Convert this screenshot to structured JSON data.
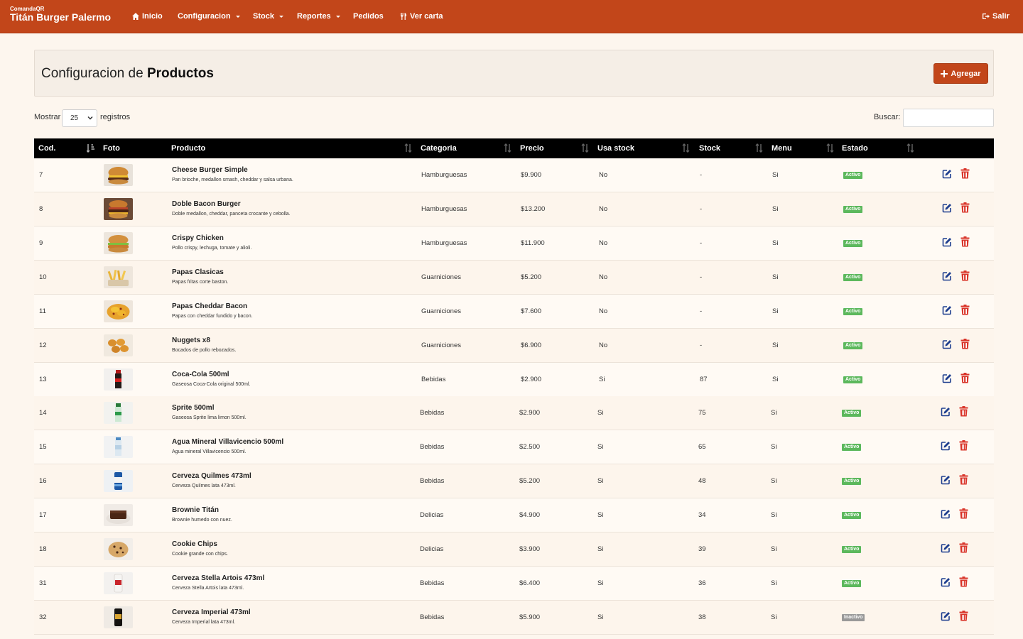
{
  "navbar": {
    "brand_small": "ComandaQR",
    "brand_big": "Titán Burger Palermo",
    "items": [
      {
        "label": "Inicio",
        "icon": "home-icon"
      },
      {
        "label": "Configuracion",
        "dropdown": true
      },
      {
        "label": "Stock",
        "dropdown": true
      },
      {
        "label": "Reportes",
        "dropdown": true
      },
      {
        "label": "Pedidos"
      },
      {
        "label": "Ver carta",
        "icon": "cutlery-icon"
      }
    ],
    "logout": "Salir"
  },
  "panel": {
    "title_prefix": "Configuracion de",
    "title_bold": "Productos",
    "add_label": "Agregar"
  },
  "controls": {
    "show_label": "Mostrar",
    "page_size": "25",
    "records_label": "registros",
    "search_label": "Buscar:",
    "search_value": ""
  },
  "table": {
    "columns": [
      "Cod.",
      "Foto",
      "Producto",
      "Categoria",
      "Precio",
      "Usa stock",
      "Stock",
      "Menu",
      "Estado"
    ],
    "rows": [
      {
        "cod": "7",
        "image": "cheeseburger",
        "name": "Cheese Burger Simple",
        "desc": "Pan brioche, medallon smash, cheddar y salsa urbana.",
        "category": "Hamburguesas",
        "price": "$9.900",
        "uses_stock": "No",
        "stock": "-",
        "menu": "Si",
        "status": "Activo"
      },
      {
        "cod": "8",
        "image": "bacon-burger",
        "name": "Doble Bacon Burger",
        "desc": "Doble medallon, cheddar, panceta crocante y cebolla.",
        "category": "Hamburguesas",
        "price": "$13.200",
        "uses_stock": "No",
        "stock": "-",
        "menu": "Si",
        "status": "Activo"
      },
      {
        "cod": "9",
        "image": "chicken-burger",
        "name": "Crispy Chicken",
        "desc": "Pollo crispy, lechuga, tomate y alioli.",
        "category": "Hamburguesas",
        "price": "$11.900",
        "uses_stock": "No",
        "stock": "-",
        "menu": "Si",
        "status": "Activo"
      },
      {
        "cod": "10",
        "image": "fries",
        "name": "Papas Clasicas",
        "desc": "Papas fritas corte baston.",
        "category": "Guarniciones",
        "price": "$5.200",
        "uses_stock": "No",
        "stock": "-",
        "menu": "Si",
        "status": "Activo"
      },
      {
        "cod": "11",
        "image": "cheddar-fries",
        "name": "Papas Cheddar Bacon",
        "desc": "Papas con cheddar fundido y bacon.",
        "category": "Guarniciones",
        "price": "$7.600",
        "uses_stock": "No",
        "stock": "-",
        "menu": "Si",
        "status": "Activo"
      },
      {
        "cod": "12",
        "image": "nuggets",
        "name": "Nuggets x8",
        "desc": "Bocados de pollo rebozados.",
        "category": "Guarniciones",
        "price": "$6.900",
        "uses_stock": "No",
        "stock": "-",
        "menu": "Si",
        "status": "Activo"
      },
      {
        "cod": "13",
        "image": "coca-cola",
        "name": "Coca-Cola 500ml",
        "desc": "Gaseosa Coca-Cola original 500ml.",
        "category": "Bebidas",
        "price": "$2.900",
        "uses_stock": "Si",
        "stock": "87",
        "menu": "Si",
        "status": "Activo"
      },
      {
        "cod": "14",
        "image": "sprite",
        "name": "Sprite 500ml",
        "desc": "Gaseosa Sprite lima limon 500ml.",
        "category": "Bebidas",
        "price": "$2.900",
        "uses_stock": "Si",
        "stock": "75",
        "menu": "Si",
        "status": "Activo"
      },
      {
        "cod": "15",
        "image": "water",
        "name": "Agua Mineral Villavicencio 500ml",
        "desc": "Agua mineral Villavicencio 500ml.",
        "category": "Bebidas",
        "price": "$2.500",
        "uses_stock": "Si",
        "stock": "65",
        "menu": "Si",
        "status": "Activo"
      },
      {
        "cod": "16",
        "image": "quilmes",
        "name": "Cerveza Quilmes 473ml",
        "desc": "Cerveza Quilmes lata 473ml.",
        "category": "Bebidas",
        "price": "$5.200",
        "uses_stock": "Si",
        "stock": "48",
        "menu": "Si",
        "status": "Activo"
      },
      {
        "cod": "17",
        "image": "brownie",
        "name": "Brownie Titán",
        "desc": "Brownie humedo con nuez.",
        "category": "Delicias",
        "price": "$4.900",
        "uses_stock": "Si",
        "stock": "34",
        "menu": "Si",
        "status": "Activo"
      },
      {
        "cod": "18",
        "image": "cookie",
        "name": "Cookie Chips",
        "desc": "Cookie grande con chips.",
        "category": "Delicias",
        "price": "$3.900",
        "uses_stock": "Si",
        "stock": "39",
        "menu": "Si",
        "status": "Activo"
      },
      {
        "cod": "31",
        "image": "stella",
        "name": "Cerveza Stella Artois 473ml",
        "desc": "Cerveza Stella Artois lata 473ml.",
        "category": "Bebidas",
        "price": "$6.400",
        "uses_stock": "Si",
        "stock": "36",
        "menu": "Si",
        "status": "Activo"
      },
      {
        "cod": "32",
        "image": "imperial",
        "name": "Cerveza Imperial 473ml",
        "desc": "Cerveza Imperial lata 473ml.",
        "category": "Bebidas",
        "price": "$5.900",
        "uses_stock": "Si",
        "stock": "38",
        "menu": "Si",
        "status": "Inactivo"
      }
    ]
  },
  "colors": {
    "navbar": "#c2461a",
    "active_badge": "#5cb85c",
    "inactive_badge": "#999999",
    "edit_icon": "#1f3f8f",
    "delete_icon": "#d9352a"
  }
}
